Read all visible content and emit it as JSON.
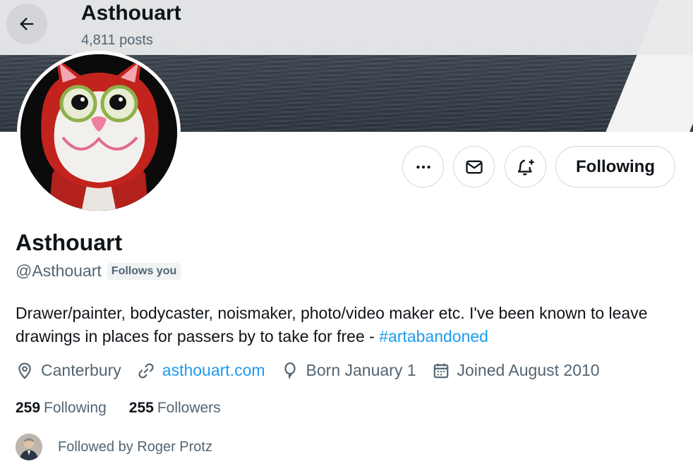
{
  "header": {
    "title": "Asthouart",
    "posts_count": "4,811 posts",
    "back_icon": "arrow-left-icon"
  },
  "profile": {
    "display_name": "Asthouart",
    "handle": "@Asthouart",
    "follows_you_badge": "Follows you",
    "bio_text": "Drawer/painter, bodycaster, noismaker, photo/video maker etc. I've been known to leave drawings in places for passers by to take for free - ",
    "bio_hashtag": "#artabandoned",
    "location": "Canterbury",
    "website": "asthouart.com",
    "birthday": "Born January 1",
    "joined": "Joined August 2010"
  },
  "actions": {
    "more_icon": "ellipsis-icon",
    "message_icon": "envelope-icon",
    "notify_icon": "bell-plus-icon",
    "following_label": "Following"
  },
  "stats": {
    "following_count": "259",
    "following_label": "Following",
    "followers_count": "255",
    "followers_label": "Followers"
  },
  "followed_by": {
    "text": "Followed by Roger Protz"
  },
  "colors": {
    "accent": "#1d9bf0",
    "text_primary": "#0f1419",
    "text_secondary": "#536471",
    "border": "#cfd9de"
  }
}
